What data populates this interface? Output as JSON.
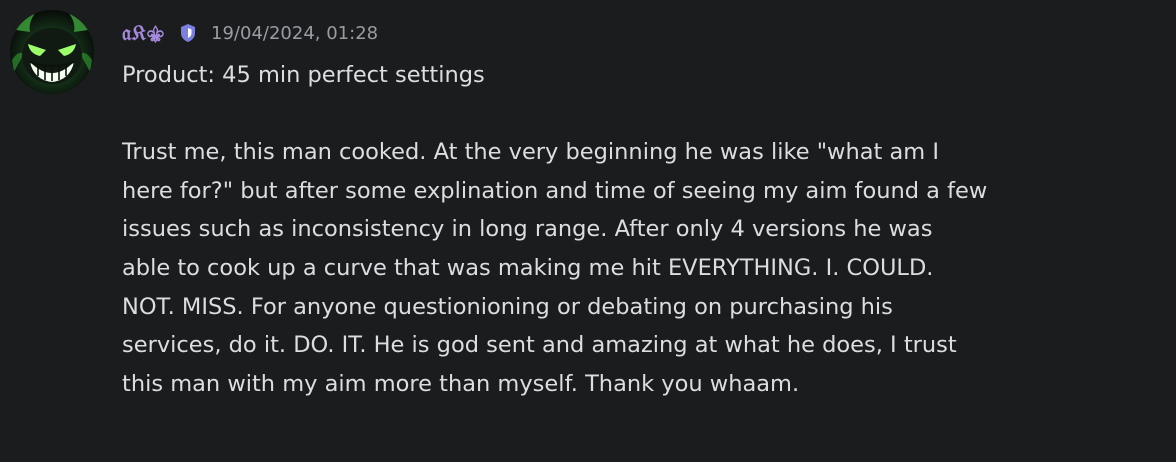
{
  "message": {
    "author": {
      "username": "𝔞𝔎⚜",
      "avatar_icon": "grinning-green-face-icon",
      "badge_icon": "shield-badge-icon",
      "badge_color": "#7b7fe0",
      "name_color": "#a488d9"
    },
    "timestamp": "19/04/2024, 01:28",
    "product_line": "Product: 45 min perfect settings",
    "body_lines": [
      "Trust me, this man cooked. At the very beginning he was like \"what am I",
      "here for?\" but after some explination and time of seeing my aim found a few",
      "issues such as inconsistency in long range. After only 4 versions he was",
      "able to cook up a curve that was making me hit EVERYTHING. I. COULD.",
      "NOT. MISS. For anyone questionioning or debating on purchasing his",
      "services, do it. DO. IT. He is god sent and amazing at what he does, I trust",
      "this man with my aim more than myself. Thank you whaam."
    ]
  },
  "colors": {
    "background": "#1a1c1e",
    "text": "#dcdde0",
    "timestamp": "#9a9ca3"
  }
}
